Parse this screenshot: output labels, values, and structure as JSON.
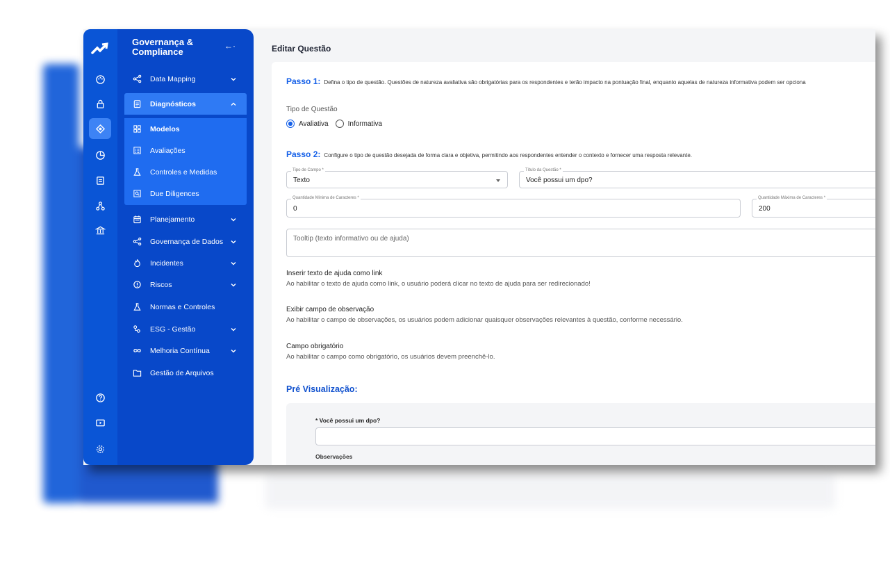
{
  "colors": {
    "rail": "#0a55d6",
    "sidebar": "#0848c9",
    "active": "#2f7af4",
    "accent": "#1560e8"
  },
  "rail_icons": [
    "logo-icon",
    "palette-icon",
    "lock-icon",
    "diagnostics-icon",
    "pie-chart-icon",
    "clipboard-icon",
    "network-icon",
    "bank-icon",
    "help-icon",
    "video-icon",
    "settings-icon"
  ],
  "sidebar": {
    "title": "Governança & Compliance",
    "collapse_icon": "←·",
    "items": [
      {
        "label": "Data Mapping",
        "icon": "share-icon",
        "chevron": "down"
      },
      {
        "label": "Diagnósticos",
        "icon": "clipboard-icon",
        "chevron": "up",
        "open": true
      },
      {
        "label": "Modelos",
        "icon": "grid-icon"
      },
      {
        "label": "Avaliações",
        "icon": "form-icon"
      },
      {
        "label": "Controles e Medidas",
        "icon": "flask-icon"
      },
      {
        "label": "Due Diligences",
        "icon": "search-doc-icon"
      },
      {
        "label": "Planejamento",
        "icon": "calendar-icon",
        "chevron": "down"
      },
      {
        "label": "Governança de Dados",
        "icon": "share-icon",
        "chevron": "down"
      },
      {
        "label": "Incidentes",
        "icon": "fire-icon",
        "chevron": "down"
      },
      {
        "label": "Riscos",
        "icon": "alert-circle-icon",
        "chevron": "down"
      },
      {
        "label": "Normas e Controles",
        "icon": "flask-icon"
      },
      {
        "label": "ESG - Gestão",
        "icon": "esg-icon",
        "chevron": "down"
      },
      {
        "label": "Melhoria Contínua",
        "icon": "infinity-icon",
        "chevron": "down"
      },
      {
        "label": "Gestão de Arquivos",
        "icon": "folder-icon"
      }
    ]
  },
  "main": {
    "title": "Editar Questão",
    "step1": {
      "label": "Passo 1:",
      "text": "Defina o tipo de questão. Questões de natureza avaliativa são obrigatórias para os respondentes e terão impacto na pontuação final, enquanto aquelas de natureza informativa podem ser opciona"
    },
    "question_type_label": "Tipo de Questão",
    "question_type_options": [
      "Avaliativa",
      "Informativa"
    ],
    "question_type_selected": "Avaliativa",
    "step2": {
      "label": "Passo 2:",
      "text": "Configure o tipo de questão desejada de forma clara e objetiva, permitindo aos respondentes entender o contexto e fornecer uma resposta relevante."
    },
    "field_type": {
      "label": "Tipo de Campo *",
      "value": "Texto"
    },
    "question_title": {
      "label": "Título da Questão *",
      "value": "Você possui um dpo?"
    },
    "min_chars": {
      "label": "Quantidade Mínima de Caracteres *",
      "value": "0"
    },
    "max_chars": {
      "label": "Quantidade Máxima de Caracteres *",
      "value": "200"
    },
    "tooltip_placeholder": "Tooltip (texto informativo ou de ajuda)",
    "options": [
      {
        "title": "Inserir texto de ajuda como link",
        "desc": "Ao habilitar o texto de ajuda como link, o usuário poderá clicar no texto de ajuda para ser redirecionado!"
      },
      {
        "title": "Exibir campo de observação",
        "desc": "Ao habilitar o campo de observações, os usuários podem adicionar quaisquer observações relevantes à questão, conforme necessário."
      },
      {
        "title": "Campo obrigatório",
        "desc": "Ao habilitar o campo como obrigatório, os usuários devem preenchê-lo."
      }
    ],
    "preview": {
      "title": "Pré Visualização:",
      "question": "* Você possui um dpo?",
      "observations_label": "Observações"
    }
  }
}
